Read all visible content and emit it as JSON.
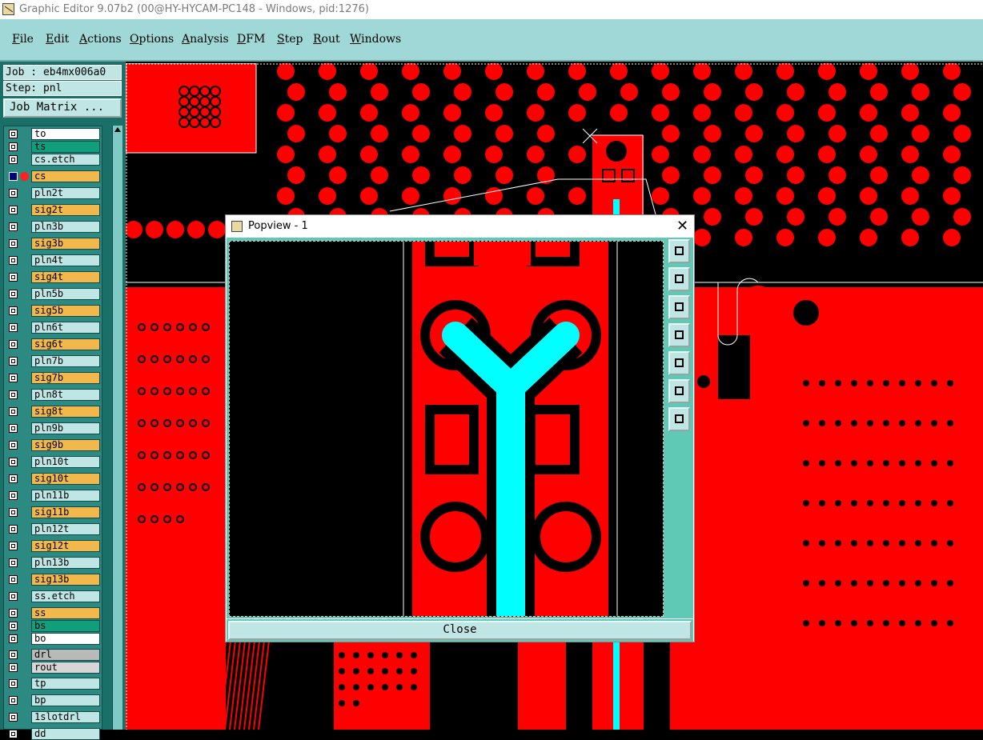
{
  "window": {
    "title": "Graphic Editor 9.07b2 (00@HY-HYCAM-PC148 - Windows, pid:1276)"
  },
  "menu": [
    {
      "label": "File",
      "mnemonic": "F",
      "rest": "ile"
    },
    {
      "label": "Edit",
      "mnemonic": "E",
      "rest": "dit"
    },
    {
      "label": "Actions",
      "mnemonic": "A",
      "rest": "ctions"
    },
    {
      "label": "Options",
      "mnemonic": "O",
      "rest": "ptions"
    },
    {
      "label": "Analysis",
      "mnemonic": "A",
      "rest": "nalysis"
    },
    {
      "label": "DFM",
      "mnemonic": "D",
      "rest": "FM"
    },
    {
      "label": "Step",
      "mnemonic": "S",
      "rest": "tep"
    },
    {
      "label": "Rout",
      "mnemonic": "R",
      "rest": "out"
    },
    {
      "label": "Windows",
      "mnemonic": "W",
      "rest": "indows"
    }
  ],
  "job": {
    "job_label": "Job : eb4mx006a0",
    "step_label": "Step: pnl",
    "matrix_button": "Job Matrix ..."
  },
  "layers": [
    {
      "name": "to",
      "color": "#ffffff"
    },
    {
      "name": "ts",
      "color": "#119e7d"
    },
    {
      "name": "cs.etch",
      "color": "#bfe6e4"
    },
    {
      "name": "cs",
      "color": "#f2b84b",
      "active": true
    },
    {
      "name": "pln2t",
      "color": "#bfe6e4"
    },
    {
      "name": "sig2t",
      "color": "#f2b84b"
    },
    {
      "name": "pln3b",
      "color": "#bfe6e4"
    },
    {
      "name": "sig3b",
      "color": "#f2b84b"
    },
    {
      "name": "pln4t",
      "color": "#bfe6e4"
    },
    {
      "name": "sig4t",
      "color": "#f2b84b"
    },
    {
      "name": "pln5b",
      "color": "#bfe6e4"
    },
    {
      "name": "sig5b",
      "color": "#f2b84b"
    },
    {
      "name": "pln6t",
      "color": "#bfe6e4"
    },
    {
      "name": "sig6t",
      "color": "#f2b84b"
    },
    {
      "name": "pln7b",
      "color": "#bfe6e4"
    },
    {
      "name": "sig7b",
      "color": "#f2b84b"
    },
    {
      "name": "pln8t",
      "color": "#bfe6e4"
    },
    {
      "name": "sig8t",
      "color": "#f2b84b"
    },
    {
      "name": "pln9b",
      "color": "#bfe6e4"
    },
    {
      "name": "sig9b",
      "color": "#f2b84b"
    },
    {
      "name": "pln10t",
      "color": "#bfe6e4"
    },
    {
      "name": "sig10t",
      "color": "#f2b84b"
    },
    {
      "name": "pln11b",
      "color": "#bfe6e4"
    },
    {
      "name": "sig11b",
      "color": "#f2b84b"
    },
    {
      "name": "pln12t",
      "color": "#bfe6e4"
    },
    {
      "name": "sig12t",
      "color": "#f2b84b"
    },
    {
      "name": "pln13b",
      "color": "#bfe6e4"
    },
    {
      "name": "sig13b",
      "color": "#f2b84b"
    },
    {
      "name": "ss.etch",
      "color": "#bfe6e4"
    },
    {
      "name": "ss",
      "color": "#f2b84b"
    },
    {
      "name": "bs",
      "color": "#119e7d"
    },
    {
      "name": "bo",
      "color": "#ffffff"
    },
    {
      "name": "drl",
      "color": "#b9b9b9"
    },
    {
      "name": "rout",
      "color": "#d6d6d6"
    },
    {
      "name": "tp",
      "color": "#bfe6e4"
    },
    {
      "name": "bp",
      "color": "#bfe6e4"
    },
    {
      "name": "1slotdrl",
      "color": "#bfe6e4"
    },
    {
      "name": "dd",
      "color": "#bfe6e4"
    }
  ],
  "popview": {
    "title": "Popview - 1",
    "close_label": "Close",
    "tool_icons": [
      "zoom-fit-icon",
      "pan-up-icon",
      "pan-down-icon",
      "pan-left-icon",
      "pan-right-icon",
      "zoom-out-icon",
      "zoom-in-icon"
    ]
  },
  "colors": {
    "copper": "#ff0000",
    "trace_highlight": "#00ffff",
    "panel_bg": "#1a6f69",
    "menu_bg": "#9fd8d6"
  }
}
